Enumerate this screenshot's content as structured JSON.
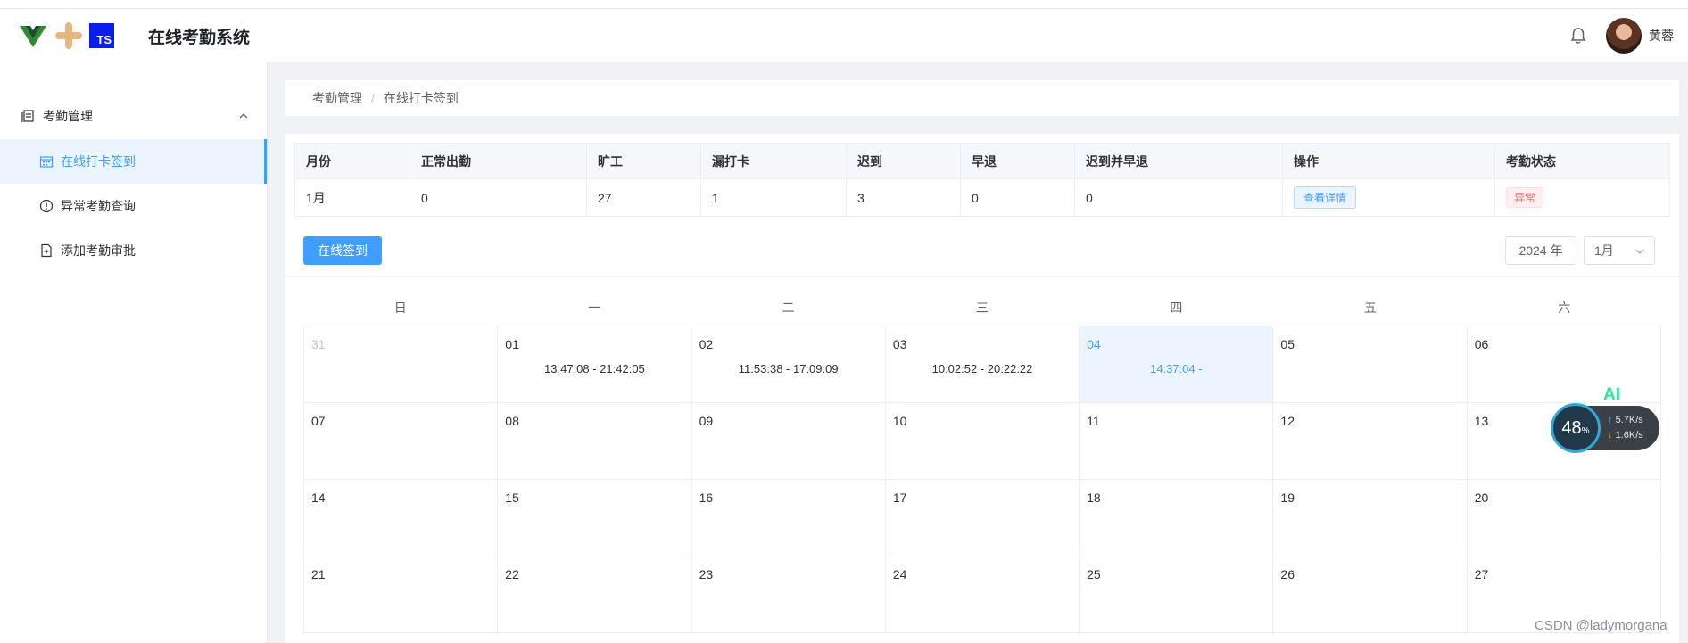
{
  "header": {
    "logo_ts": "TS",
    "title": "在线考勤系统",
    "username": "黄蓉"
  },
  "sidebar": {
    "group_label": "考勤管理",
    "items": [
      {
        "label": "在线打卡签到",
        "icon": "calendar-icon",
        "active": true
      },
      {
        "label": "异常考勤查询",
        "icon": "warning-circle-icon",
        "active": false
      },
      {
        "label": "添加考勤审批",
        "icon": "document-add-icon",
        "active": false
      }
    ]
  },
  "breadcrumb": [
    "考勤管理",
    "在线打卡签到"
  ],
  "summary": {
    "headers": [
      "月份",
      "正常出勤",
      "旷工",
      "漏打卡",
      "迟到",
      "早退",
      "迟到并早退",
      "操作",
      "考勤状态"
    ],
    "row": {
      "month": "1月",
      "normal": "0",
      "absent": "27",
      "missed": "1",
      "late": "3",
      "early": "0",
      "late_and_early": "0",
      "action": "查看详情",
      "status": "异常"
    }
  },
  "controls": {
    "signin_label": "在线签到",
    "year": "2024 年",
    "month": "1月"
  },
  "calendar": {
    "weekdays": [
      "日",
      "一",
      "二",
      "三",
      "四",
      "五",
      "六"
    ],
    "cells": [
      {
        "day": "31",
        "time": ""
      },
      {
        "day": "01",
        "time": "13:47:08 - 21:42:05"
      },
      {
        "day": "02",
        "time": "11:53:38 - 17:09:09"
      },
      {
        "day": "03",
        "time": "10:02:52 - 20:22:22"
      },
      {
        "day": "04",
        "time": "14:37:04 -"
      },
      {
        "day": "05",
        "time": ""
      },
      {
        "day": "06",
        "time": ""
      },
      {
        "day": "07",
        "time": ""
      },
      {
        "day": "08",
        "time": ""
      },
      {
        "day": "09",
        "time": ""
      },
      {
        "day": "10",
        "time": ""
      },
      {
        "day": "11",
        "time": ""
      },
      {
        "day": "12",
        "time": ""
      },
      {
        "day": "13",
        "time": ""
      },
      {
        "day": "14",
        "time": ""
      },
      {
        "day": "15",
        "time": ""
      },
      {
        "day": "16",
        "time": ""
      },
      {
        "day": "17",
        "time": ""
      },
      {
        "day": "18",
        "time": ""
      },
      {
        "day": "19",
        "time": ""
      },
      {
        "day": "20",
        "time": ""
      },
      {
        "day": "21",
        "time": ""
      },
      {
        "day": "22",
        "time": ""
      },
      {
        "day": "23",
        "time": ""
      },
      {
        "day": "24",
        "time": ""
      },
      {
        "day": "25",
        "time": ""
      },
      {
        "day": "26",
        "time": ""
      },
      {
        "day": "27",
        "time": ""
      }
    ]
  },
  "widget": {
    "ai_label": "AI",
    "percent": "48",
    "percent_unit": "%",
    "upload": "5.7K/s",
    "download": "1.6K/s"
  },
  "watermark": "CSDN @ladymorgana",
  "colors": {
    "primary": "#409eff",
    "danger": "#f56c6c",
    "today_bg": "#ecf5ff"
  }
}
